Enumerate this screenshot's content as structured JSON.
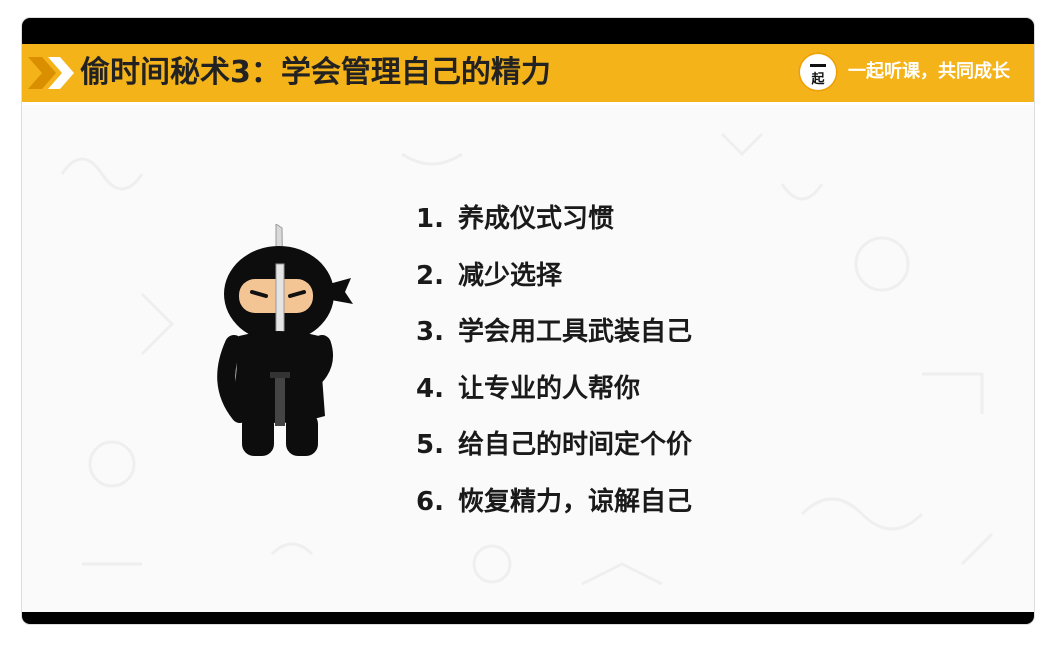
{
  "slide": {
    "title": "偷时间秘术3：学会管理自己的精力",
    "brand": {
      "logo_text": "起",
      "slogan": "一起听课，共同成长"
    },
    "items": [
      {
        "num": "1.",
        "text": "养成仪式习惯"
      },
      {
        "num": "2.",
        "text": "减少选择"
      },
      {
        "num": "3.",
        "text": "学会用工具武装自己"
      },
      {
        "num": "4.",
        "text": "让专业的人帮你"
      },
      {
        "num": "5.",
        "text": "给自己的时间定个价"
      },
      {
        "num": "6.",
        "text": "恢复精力，谅解自己"
      }
    ]
  },
  "icons": {
    "chevrons": "double-chevron-right-icon",
    "illustration": "ninja-with-sword-icon"
  },
  "colors": {
    "title_bar": "#f5b31a",
    "chevron_dark": "#d98f00",
    "chevron_light": "#ffffff",
    "frame": "#000000",
    "text": "#1a1a1a"
  }
}
